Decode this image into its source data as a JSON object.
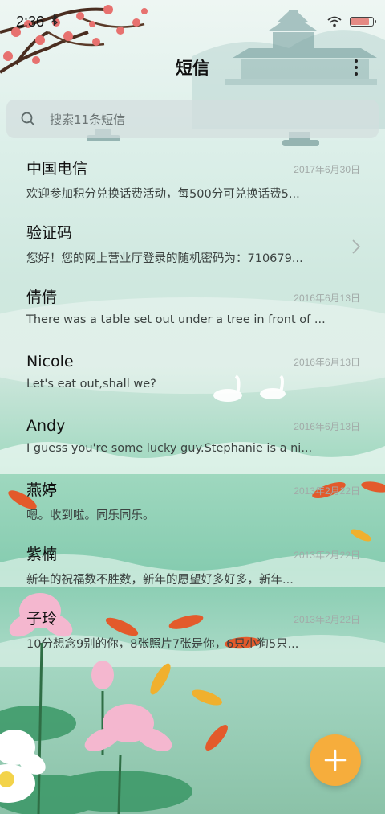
{
  "status_bar": {
    "time": "2:36",
    "bluetooth_icon": "bluetooth-icon",
    "wifi_icon": "wifi-icon",
    "battery_icon": "battery-icon"
  },
  "header": {
    "title": "短信",
    "more_icon": "more-vertical-icon"
  },
  "search": {
    "placeholder": "搜索11条短信",
    "icon": "search-icon"
  },
  "messages": [
    {
      "name": "中国电信",
      "date": "2017年6月30日",
      "preview": "欢迎参加积分兑换话费活动，每500分可兑换话费5..."
    },
    {
      "name": "验证码",
      "date": "",
      "preview": "您好！您的网上营业厅登录的随机密码为：710679..."
    },
    {
      "name": "倩倩",
      "date": "2016年6月13日",
      "preview": "There was a table set out under a tree in front of ..."
    },
    {
      "name": "Nicole",
      "date": "2016年6月13日",
      "preview": "Let's eat out,shall we?"
    },
    {
      "name": "Andy",
      "date": "2016年6月13日",
      "preview": "I guess you're some lucky guy.Stephanie is a ni..."
    },
    {
      "name": "燕婷",
      "date": "2013年2月22日",
      "preview": "嗯。收到啦。同乐同乐。"
    },
    {
      "name": "紫楠",
      "date": "2013年2月22日",
      "preview": "新年的祝福数不胜数，新年的愿望好多好多，新年..."
    },
    {
      "name": "子玲",
      "date": "2013年2月22日",
      "preview": "10分想念9别的你，8张照片7张是你，6只小狗5只..."
    }
  ],
  "fab": {
    "icon": "plus-icon"
  },
  "colors": {
    "accent": "#f6ad3c",
    "date_text": "#a2aaa8",
    "preview_text": "#3b4240"
  }
}
